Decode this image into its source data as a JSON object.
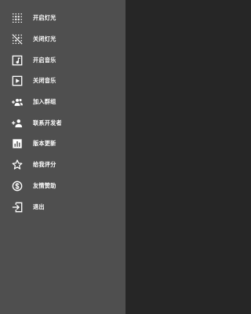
{
  "colors": {
    "drawer_background": "#4f4f4f",
    "screen_background": "#262626",
    "text": "#ffffff"
  },
  "menu": {
    "items": [
      {
        "label": "开启灯光",
        "icon": "light-on-icon"
      },
      {
        "label": "关闭灯光",
        "icon": "light-off-icon"
      },
      {
        "label": "开启音乐",
        "icon": "music-note-icon"
      },
      {
        "label": "关闭音乐",
        "icon": "play-box-icon"
      },
      {
        "label": "加入群组",
        "icon": "group-add-icon"
      },
      {
        "label": "联系开发者",
        "icon": "person-add-icon"
      },
      {
        "label": "版本更新",
        "icon": "chart-icon"
      },
      {
        "label": "给我评分",
        "icon": "star-icon"
      },
      {
        "label": "友情赞助",
        "icon": "dollar-coin-icon"
      },
      {
        "label": "退出",
        "icon": "exit-icon"
      }
    ]
  }
}
